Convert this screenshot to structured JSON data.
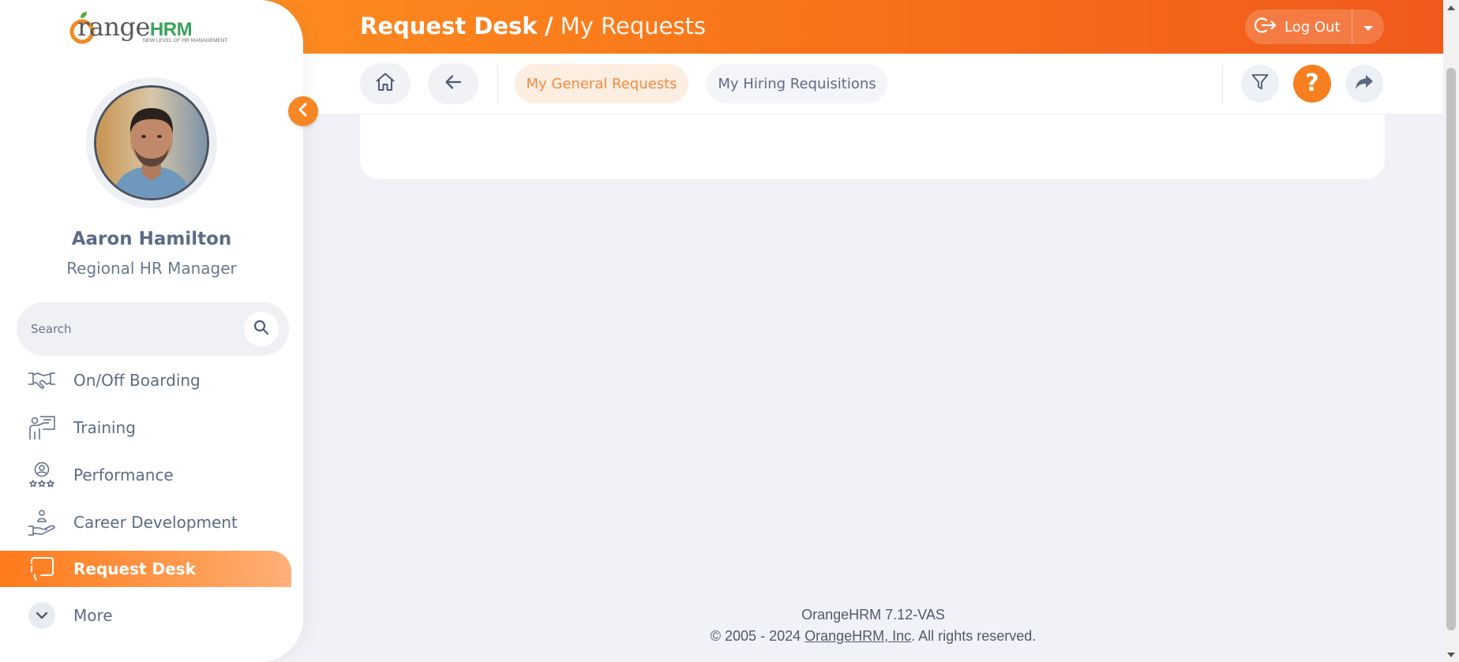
{
  "header": {
    "module": "Request Desk",
    "separator": "/",
    "page": "My Requests",
    "logout_label": "Log Out"
  },
  "toolbar": {
    "tabs": [
      {
        "label": "My General Requests",
        "active": true
      },
      {
        "label": "My Hiring Requisitions",
        "active": false
      }
    ]
  },
  "brand": {
    "word": "range",
    "initial": "O",
    "hrm": "HRM",
    "tagline": "NEW LEVEL OF HR MANAGEMENT"
  },
  "user": {
    "name": "Aaron Hamilton",
    "role": "Regional HR Manager"
  },
  "search": {
    "placeholder": "Search"
  },
  "menu": {
    "items": [
      {
        "label": "On/Off Boarding",
        "icon": "handshake-icon"
      },
      {
        "label": "Training",
        "icon": "training-presenter-icon"
      },
      {
        "label": "Performance",
        "icon": "performance-award-icon"
      },
      {
        "label": "Career Development",
        "icon": "career-hand-icon"
      },
      {
        "label": "Request Desk",
        "icon": "request-desk-icon",
        "active": true
      }
    ],
    "more_label": "More"
  },
  "footer": {
    "version": "OrangeHRM 7.12-VAS",
    "copyright_prefix": "© 2005 - 2024 ",
    "company_link": "OrangeHRM, Inc",
    "copyright_suffix": ". All rights reserved."
  },
  "colors": {
    "brand_orange": "#ff7a1a",
    "text_slate": "#5d6b85",
    "active_tab_text": "#f58a3f",
    "active_tab_bg": "#fdeee2"
  }
}
